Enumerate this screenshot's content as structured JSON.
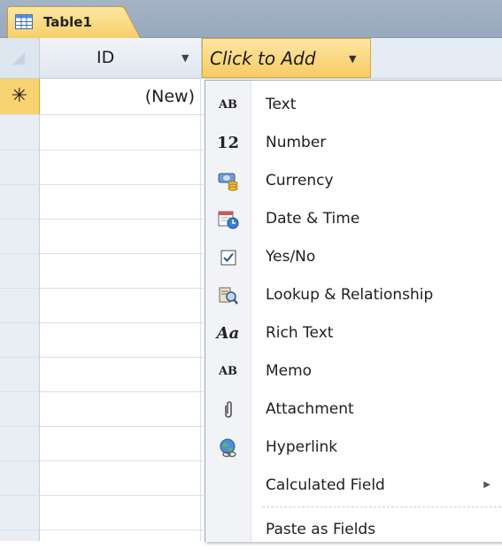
{
  "tab": {
    "label": "Table1"
  },
  "header": {
    "id_column": "ID",
    "add_column": "Click to Add"
  },
  "new_record": {
    "marker": "✳",
    "id_value": "(New)"
  },
  "menu": {
    "items": [
      {
        "label": "Text",
        "icon": "ab-text-icon",
        "icon_text": "AB"
      },
      {
        "label": "Number",
        "icon": "number-12-icon",
        "icon_text": "12"
      },
      {
        "label": "Currency",
        "icon": "currency-coins-icon"
      },
      {
        "label": "Date & Time",
        "icon": "calendar-clock-icon"
      },
      {
        "label": "Yes/No",
        "icon": "checkbox-checked-icon"
      },
      {
        "label": "Lookup & Relationship",
        "icon": "lookup-magnifier-icon"
      },
      {
        "label": "Rich Text",
        "icon": "rich-text-aa-icon",
        "icon_text": "Aa"
      },
      {
        "label": "Memo",
        "icon": "ab-memo-icon",
        "icon_text": "AB"
      },
      {
        "label": "Attachment",
        "icon": "paperclip-icon"
      },
      {
        "label": "Hyperlink",
        "icon": "globe-link-icon"
      },
      {
        "label": "Calculated Field",
        "icon": "",
        "submenu_arrow": "▶"
      },
      {
        "label": "Paste as Fields",
        "icon": ""
      }
    ]
  },
  "colors": {
    "accent_yellow": "#f8cb63",
    "header_blue": "#e6ecf4",
    "tabstrip": "#a4b3c6"
  }
}
